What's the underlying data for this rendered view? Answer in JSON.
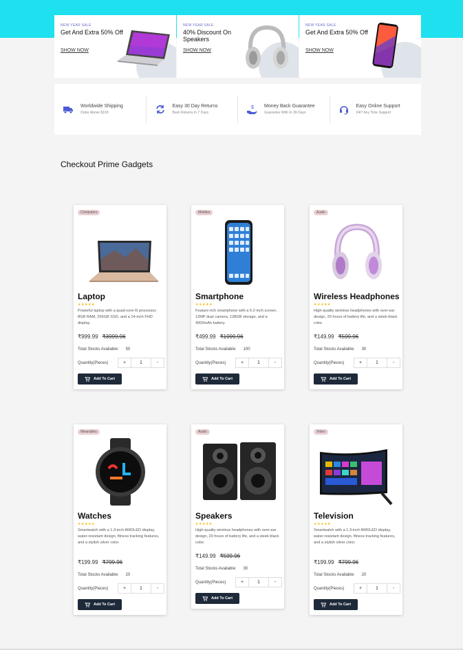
{
  "promos": [
    {
      "tag": "New Year Sale",
      "headline": "Get And Extra 50% Off",
      "cta": "Show Now",
      "icon": "laptop-icon"
    },
    {
      "tag": "New Year Sale",
      "headline": "40% Discount On Speakers",
      "cta": "Show Now",
      "icon": "headphones-icon"
    },
    {
      "tag": "New Year Sale",
      "headline": "Get And Extra 50% Off",
      "cta": "Show Now",
      "icon": "smartphone-icon"
    }
  ],
  "features": [
    {
      "title": "Worldwide Shipping",
      "subtitle": "Order Above $100",
      "icon": "truck-icon"
    },
    {
      "title": "Easy 30 Day Returns",
      "subtitle": "Back Returns In 7 Days",
      "icon": "refresh-icon"
    },
    {
      "title": "Money Back Guarantee",
      "subtitle": "Guarantee With In 30-Days",
      "icon": "money-hand-icon"
    },
    {
      "title": "Easy Online Support",
      "subtitle": "24/7 Any Time Support",
      "icon": "headset-icon"
    }
  ],
  "section_title": "Checkout Prime Gadgets",
  "labels": {
    "stock": "Total Stocks Available:",
    "quantity": "Quantity(Pieces)",
    "add_to_cart": "Add To Cart",
    "plus": "+",
    "minus": "-",
    "stars": "★★★★★"
  },
  "colors": {
    "accent_top": "#1ee0ef",
    "button": "#1e2a3a",
    "star": "#f2b705",
    "badge": "#eacfd2"
  },
  "products": [
    {
      "category": "Computers",
      "name": "Laptop",
      "description": "Powerful laptop with a quad-core i5 processor, 8GB RAM, 256GB SSD, and a 14-inch FHD display.",
      "price": "₹999.99",
      "old_price": "₹3999.96",
      "stock": "50",
      "quantity": "1",
      "image": "laptop-image"
    },
    {
      "category": "Mobiles",
      "name": "Smartphone",
      "description": "Feature-rich smartphone with a 6.2-inch screen, 12MP dual camera, 128GB storage, and a 4000mAh battery.",
      "price": "₹499.99",
      "old_price": "₹1999.96",
      "stock": "100",
      "quantity": "1",
      "image": "smartphone-image"
    },
    {
      "category": "Audio",
      "name": "Wireless Headphones",
      "description": "High-quality wireless headphones with over-ear design, 20 hours of battery life, and a sleek black color.",
      "price": "₹149.99",
      "old_price": "₹599.96",
      "stock": "30",
      "quantity": "1",
      "image": "headphones-image"
    },
    {
      "category": "Wearables",
      "name": "Watches",
      "description": "Smartwatch with a 1.3-inch AMOLED display, water-resistant design, fitness tracking features, and a stylish silver color.",
      "price": "₹199.99",
      "old_price": "₹799.96",
      "stock": "20",
      "quantity": "1",
      "image": "watch-image"
    },
    {
      "category": "Audio",
      "name": "Speakers",
      "description": "High-quality wireless headphones with over-ear design, 20 hours of battery life, and a sleek black color.",
      "price": "₹149.99",
      "old_price": "₹599.96",
      "stock": "30",
      "quantity": "1",
      "image": "speakers-image"
    },
    {
      "category": "Video",
      "name": "Television",
      "description": "Smartwatch with a 1.3-inch AMOLED display, water-resistant design, fitness tracking features, and a stylish silver color.",
      "price": "₹199.99",
      "old_price": "₹799.96",
      "stock": "20",
      "quantity": "1",
      "image": "television-image"
    }
  ]
}
